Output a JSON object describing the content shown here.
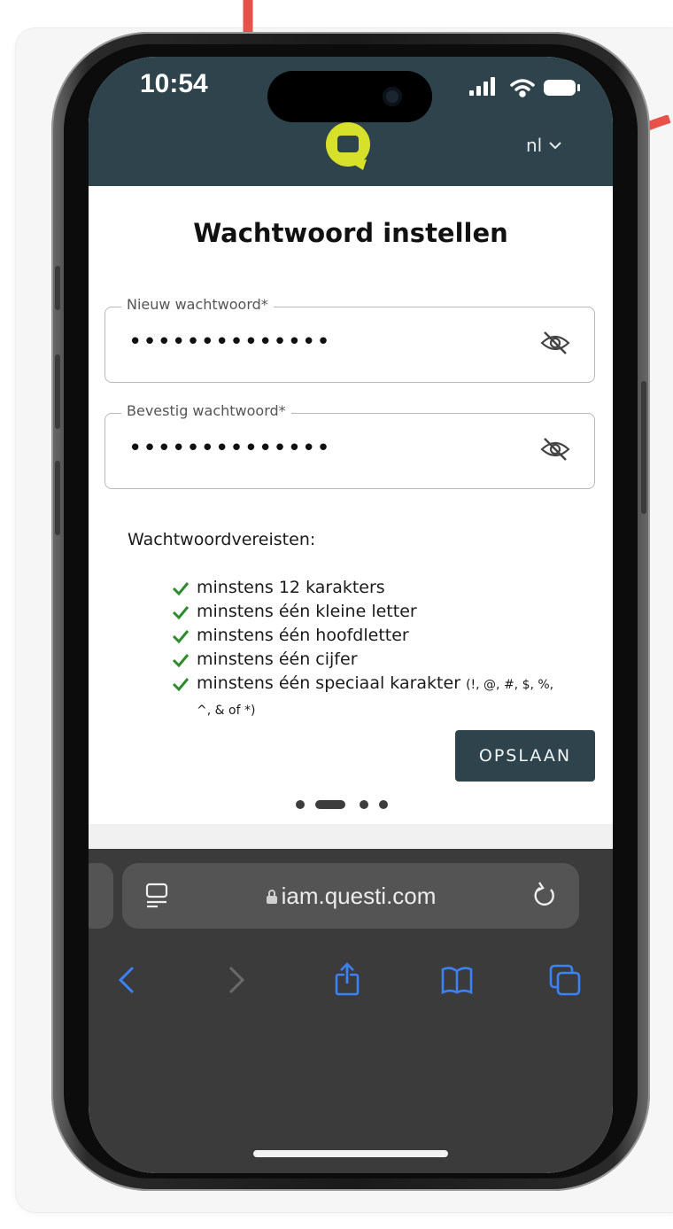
{
  "status_bar": {
    "time": "10:54"
  },
  "header": {
    "language": "nl",
    "logo_icon": "questi-logo-icon",
    "accent": "#d7e02a",
    "background": "#2e434b"
  },
  "page": {
    "title": "Wachtwoord instellen"
  },
  "form": {
    "new_password": {
      "label": "Nieuw wachtwoord*",
      "value": "••••••••••••••"
    },
    "confirm_password": {
      "label": "Bevestig wachtwoord*",
      "value": "••••••••••••••"
    },
    "visibility_icon": "eye-off-icon"
  },
  "requirements": {
    "heading": "Wachtwoordvereisten:",
    "items": [
      "minstens 12 karakters",
      "minstens één kleine letter",
      "minstens één hoofdletter",
      "minstens één cijfer",
      "minstens één speciaal karakter"
    ],
    "special_chars_first": "(!, @, #, $, %,",
    "special_chars_second": "^, & of *)",
    "check_color": "#2e8b2e"
  },
  "actions": {
    "save_label": "OPSLAAN"
  },
  "pagination": {
    "total": 4,
    "active_index": 1
  },
  "browser": {
    "url": "iam.questi.com"
  },
  "annotation": {
    "arrow_color": "#e8504a"
  }
}
